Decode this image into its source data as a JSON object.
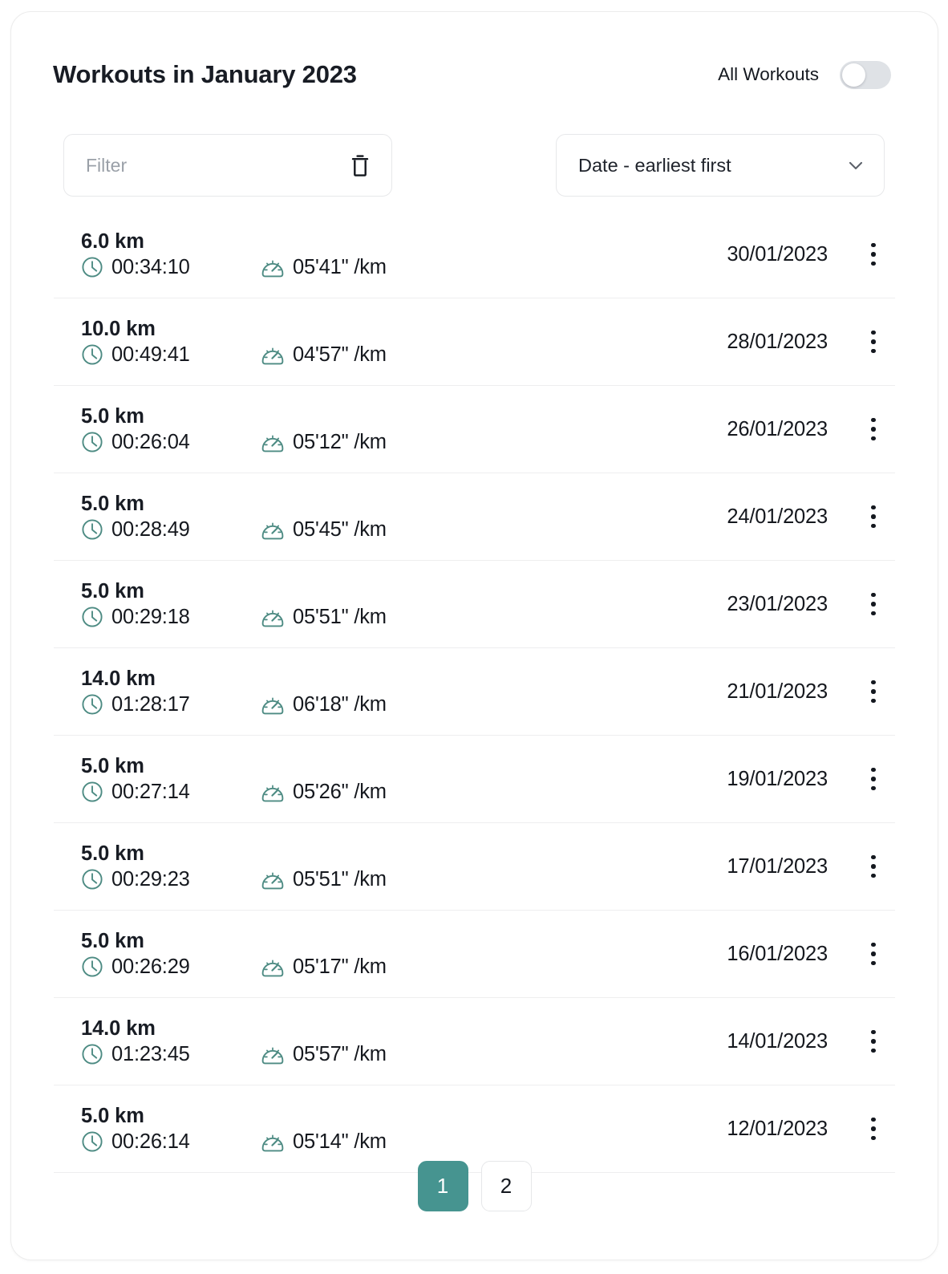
{
  "header": {
    "title": "Workouts in January 2023",
    "toggle_label": "All Workouts",
    "toggle_state": "off"
  },
  "controls": {
    "filter_placeholder": "Filter",
    "filter_value": "",
    "clear_icon": "trash-icon",
    "sort_selected": "Date - earliest first",
    "sort_chevron_icon": "chevron-down-icon"
  },
  "colors": {
    "accent": "#469490",
    "icon": "#4d8b83",
    "text": "#15181e",
    "muted": "#9aa0a8",
    "divider": "#eeeeef",
    "toggle_track": "#dfe2e6"
  },
  "list": {
    "duration_icon": "clock-icon",
    "pace_icon": "speedometer-icon",
    "row_menu_icon": "kebab-menu-icon",
    "rows": [
      {
        "distance": "6.0 km",
        "duration": "00:34:10",
        "pace": "05'41\" /km",
        "date": "30/01/2023"
      },
      {
        "distance": "10.0 km",
        "duration": "00:49:41",
        "pace": "04'57\" /km",
        "date": "28/01/2023"
      },
      {
        "distance": "5.0 km",
        "duration": "00:26:04",
        "pace": "05'12\" /km",
        "date": "26/01/2023"
      },
      {
        "distance": "5.0 km",
        "duration": "00:28:49",
        "pace": "05'45\" /km",
        "date": "24/01/2023"
      },
      {
        "distance": "5.0 km",
        "duration": "00:29:18",
        "pace": "05'51\" /km",
        "date": "23/01/2023"
      },
      {
        "distance": "14.0 km",
        "duration": "01:28:17",
        "pace": "06'18\" /km",
        "date": "21/01/2023"
      },
      {
        "distance": "5.0 km",
        "duration": "00:27:14",
        "pace": "05'26\" /km",
        "date": "19/01/2023"
      },
      {
        "distance": "5.0 km",
        "duration": "00:29:23",
        "pace": "05'51\" /km",
        "date": "17/01/2023"
      },
      {
        "distance": "5.0 km",
        "duration": "00:26:29",
        "pace": "05'17\" /km",
        "date": "16/01/2023"
      },
      {
        "distance": "14.0 km",
        "duration": "01:23:45",
        "pace": "05'57\" /km",
        "date": "14/01/2023"
      },
      {
        "distance": "5.0 km",
        "duration": "00:26:14",
        "pace": "05'14\" /km",
        "date": "12/01/2023"
      }
    ]
  },
  "pagination": {
    "pages": [
      {
        "label": "1",
        "active": true
      },
      {
        "label": "2",
        "active": false
      }
    ]
  }
}
